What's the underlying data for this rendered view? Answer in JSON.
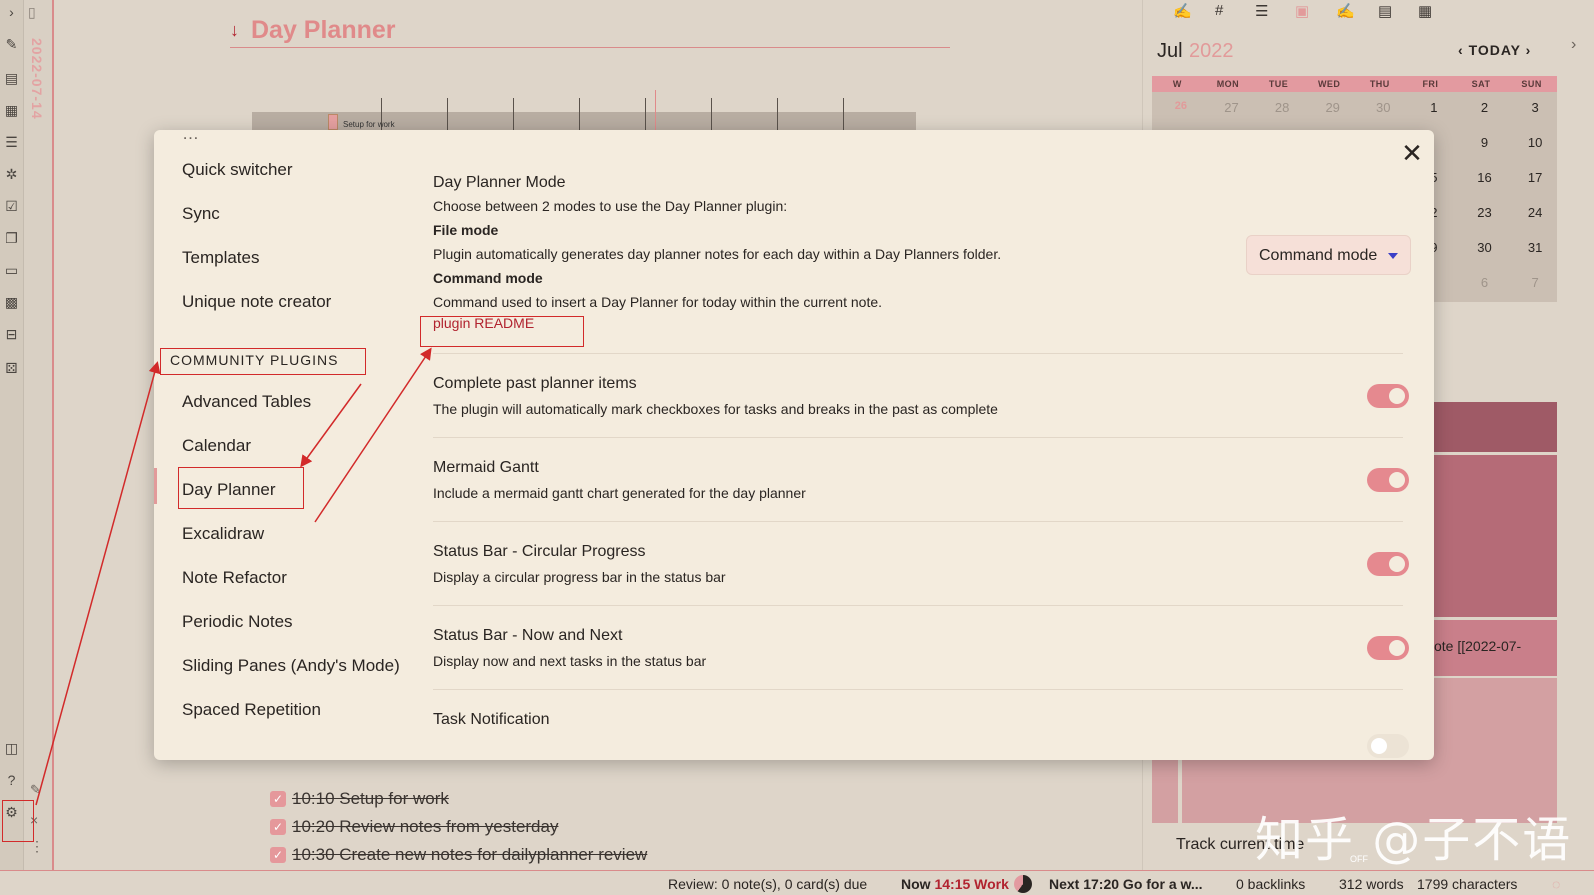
{
  "background": {
    "note_title": "Day Planner",
    "vertical_date": "2022-07-14",
    "gantt_task": "Setup for work",
    "tasks": [
      "10:10 Setup for work",
      "10:20 Review notes from yesterday",
      "10:30 Create new notes for dailyplanner review"
    ]
  },
  "calendar": {
    "month": "Jul",
    "year": "2022",
    "nav_today": "TODAY",
    "headers": [
      "W",
      "MON",
      "TUE",
      "WED",
      "THU",
      "FRI",
      "SAT",
      "SUN"
    ],
    "rows": [
      [
        "26",
        "27",
        "28",
        "29",
        "30",
        "1",
        "2",
        "3"
      ],
      [
        "",
        "",
        "",
        "",
        "",
        "",
        "9",
        "10"
      ],
      [
        "",
        "",
        "",
        "",
        "",
        "5",
        "16",
        "17"
      ],
      [
        "",
        "",
        "",
        "",
        "",
        "2",
        "23",
        "24"
      ],
      [
        "",
        "",
        "",
        "",
        "",
        "9",
        "30",
        "31"
      ],
      [
        "",
        "",
        "",
        "",
        "",
        "",
        "6",
        "7"
      ]
    ],
    "right_note_fragment": "ote [[2022-07-",
    "track_label": "Track current time",
    "track_state": "OFF"
  },
  "modal": {
    "sidebar": {
      "items_core": [
        "Quick switcher",
        "Sync",
        "Templates",
        "Unique note creator"
      ],
      "section_label": "COMMUNITY PLUGINS",
      "items_community": [
        "Advanced Tables",
        "Calendar",
        "Day Planner",
        "Excalidraw",
        "Note Refactor",
        "Periodic Notes",
        "Sliding Panes (Andy's Mode)",
        "Spaced Repetition"
      ],
      "active_item": "Day Planner"
    },
    "settings": [
      {
        "name": "Day Planner Mode",
        "desc_intro": "Choose between 2 modes to use the Day Planner plugin:",
        "file_mode_label": "File mode",
        "file_mode_desc": "Plugin automatically generates day planner notes for each day within a Day Planners folder.",
        "command_mode_label": "Command mode",
        "command_mode_desc": "Command used to insert a Day Planner for today within the current note.",
        "link": "plugin README",
        "dropdown_value": "Command mode"
      },
      {
        "name": "Complete past planner items",
        "desc": "The plugin will automatically mark checkboxes for tasks and breaks in the past as complete",
        "enabled": true
      },
      {
        "name": "Mermaid Gantt",
        "desc": "Include a mermaid gantt chart generated for the day planner",
        "enabled": true
      },
      {
        "name": "Status Bar - Circular Progress",
        "desc": "Display a circular progress bar in the status bar",
        "enabled": true
      },
      {
        "name": "Status Bar - Now and Next",
        "desc": "Display now and next tasks in the status bar",
        "enabled": true
      },
      {
        "name": "Task Notification",
        "desc": "",
        "enabled": false
      }
    ]
  },
  "status_bar": {
    "review": "Review: 0 note(s), 0 card(s) due",
    "now_label": "Now",
    "now_time": "14:15",
    "now_task": "Work",
    "next": "Next 17:20 Go for a w...",
    "backlinks": "0 backlinks",
    "words": "312 words",
    "characters": "1799 characters"
  },
  "watermark": "知乎 @子不语",
  "colors": {
    "accent": "#e5898f",
    "link": "#b1232f",
    "annotation": "#d22a2a",
    "modal_bg": "#f4ecde"
  }
}
